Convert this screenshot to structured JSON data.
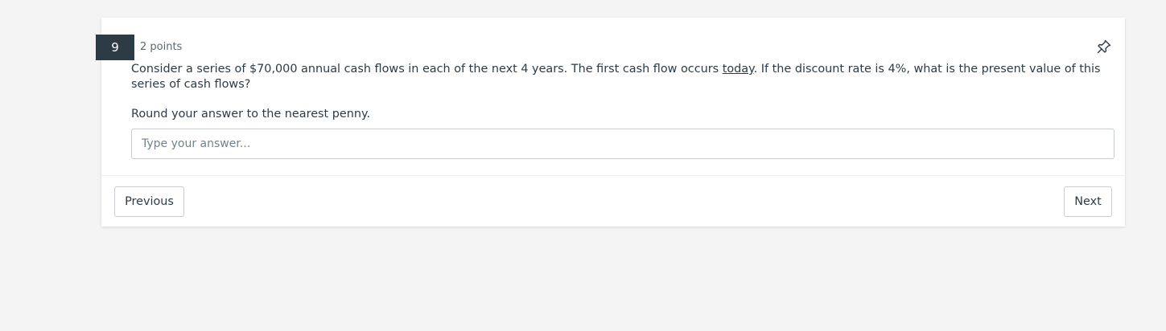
{
  "question": {
    "number": "9",
    "points": "2 points",
    "text_before": "Consider a series of $70,000 annual cash flows in each of the next 4 years. The first cash flow occurs ",
    "text_underlined": "today",
    "text_after": ". If the discount rate is 4%, what is the present value of this series of cash flows?",
    "instruction": "Round your answer to the nearest penny."
  },
  "answer": {
    "value": "",
    "placeholder": "Type your answer..."
  },
  "navigation": {
    "previous_label": "Previous",
    "next_label": "Next"
  },
  "icons": {
    "pin": "pin-icon"
  }
}
